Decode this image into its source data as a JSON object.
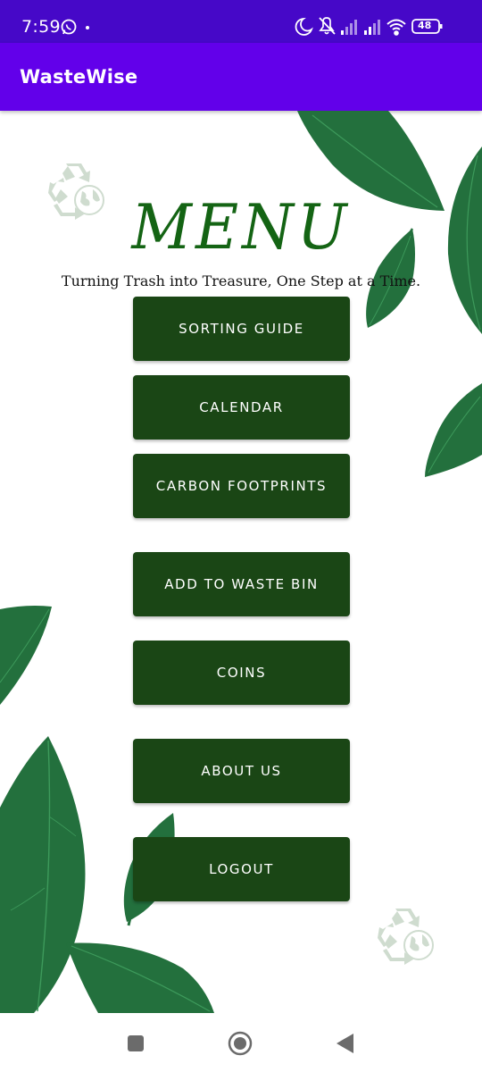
{
  "status_bar": {
    "time": "7:59",
    "battery": "48",
    "left_icons": [
      "whatsapp-icon",
      "dot-icon"
    ],
    "right_icons": [
      "moon-icon",
      "mute-icon",
      "signal-icon",
      "signal-icon",
      "wifi-icon",
      "battery-icon"
    ]
  },
  "app_bar": {
    "title": "WasteWise"
  },
  "main": {
    "heading": "MENU",
    "tagline": "Turning Trash into Treasure, One Step at a Time.",
    "buttons": [
      {
        "label": "SORTING GUIDE"
      },
      {
        "label": "CALENDAR"
      },
      {
        "label": "CARBON FOOTPRINTS"
      },
      {
        "label": "ADD TO WASTE BIN"
      },
      {
        "label": "COINS"
      },
      {
        "label": "ABOUT US"
      },
      {
        "label": "LOGOUT"
      }
    ]
  },
  "colors": {
    "status_bar": "#4608c8",
    "app_bar": "#6200ea",
    "button": "#1a4615",
    "heading": "#146414",
    "leaf": "#23703d"
  },
  "nav_bar": {
    "icons": [
      "recents-square-icon",
      "home-circle-icon",
      "back-triangle-icon"
    ]
  }
}
